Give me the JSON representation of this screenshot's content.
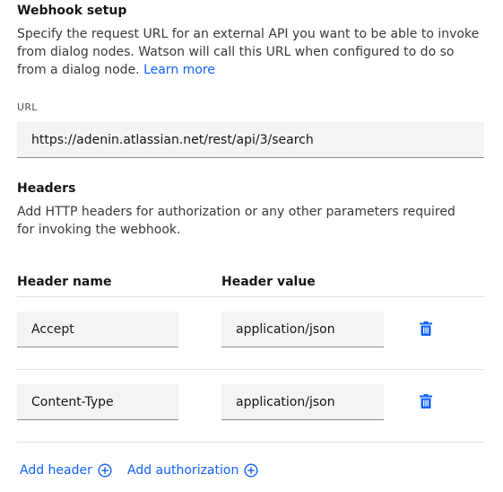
{
  "webhook": {
    "title": "Webhook setup",
    "description": "Specify the request URL for an external API you want to be able to invoke from dialog nodes. Watson will call this URL when configured to do so from a dialog node.",
    "learn_more": "Learn more"
  },
  "url_field": {
    "label": "URL",
    "value": "https://adenin.atlassian.net/rest/api/3/search"
  },
  "headers": {
    "title": "Headers",
    "description": "Add HTTP headers for authorization or any other parameters required for invoking the webhook.",
    "col_name": "Header name",
    "col_value": "Header value",
    "rows": [
      {
        "name": "Accept",
        "value": "application/json"
      },
      {
        "name": "Content-Type",
        "value": "application/json"
      }
    ]
  },
  "actions": {
    "add_header": "Add header",
    "add_authorization": "Add authorization"
  },
  "colors": {
    "link": "#0f62fe",
    "field_bg": "#f4f4f4",
    "divider": "#e0e0e0"
  },
  "icons": {
    "delete": "trash-icon",
    "add": "add-circle-icon"
  }
}
